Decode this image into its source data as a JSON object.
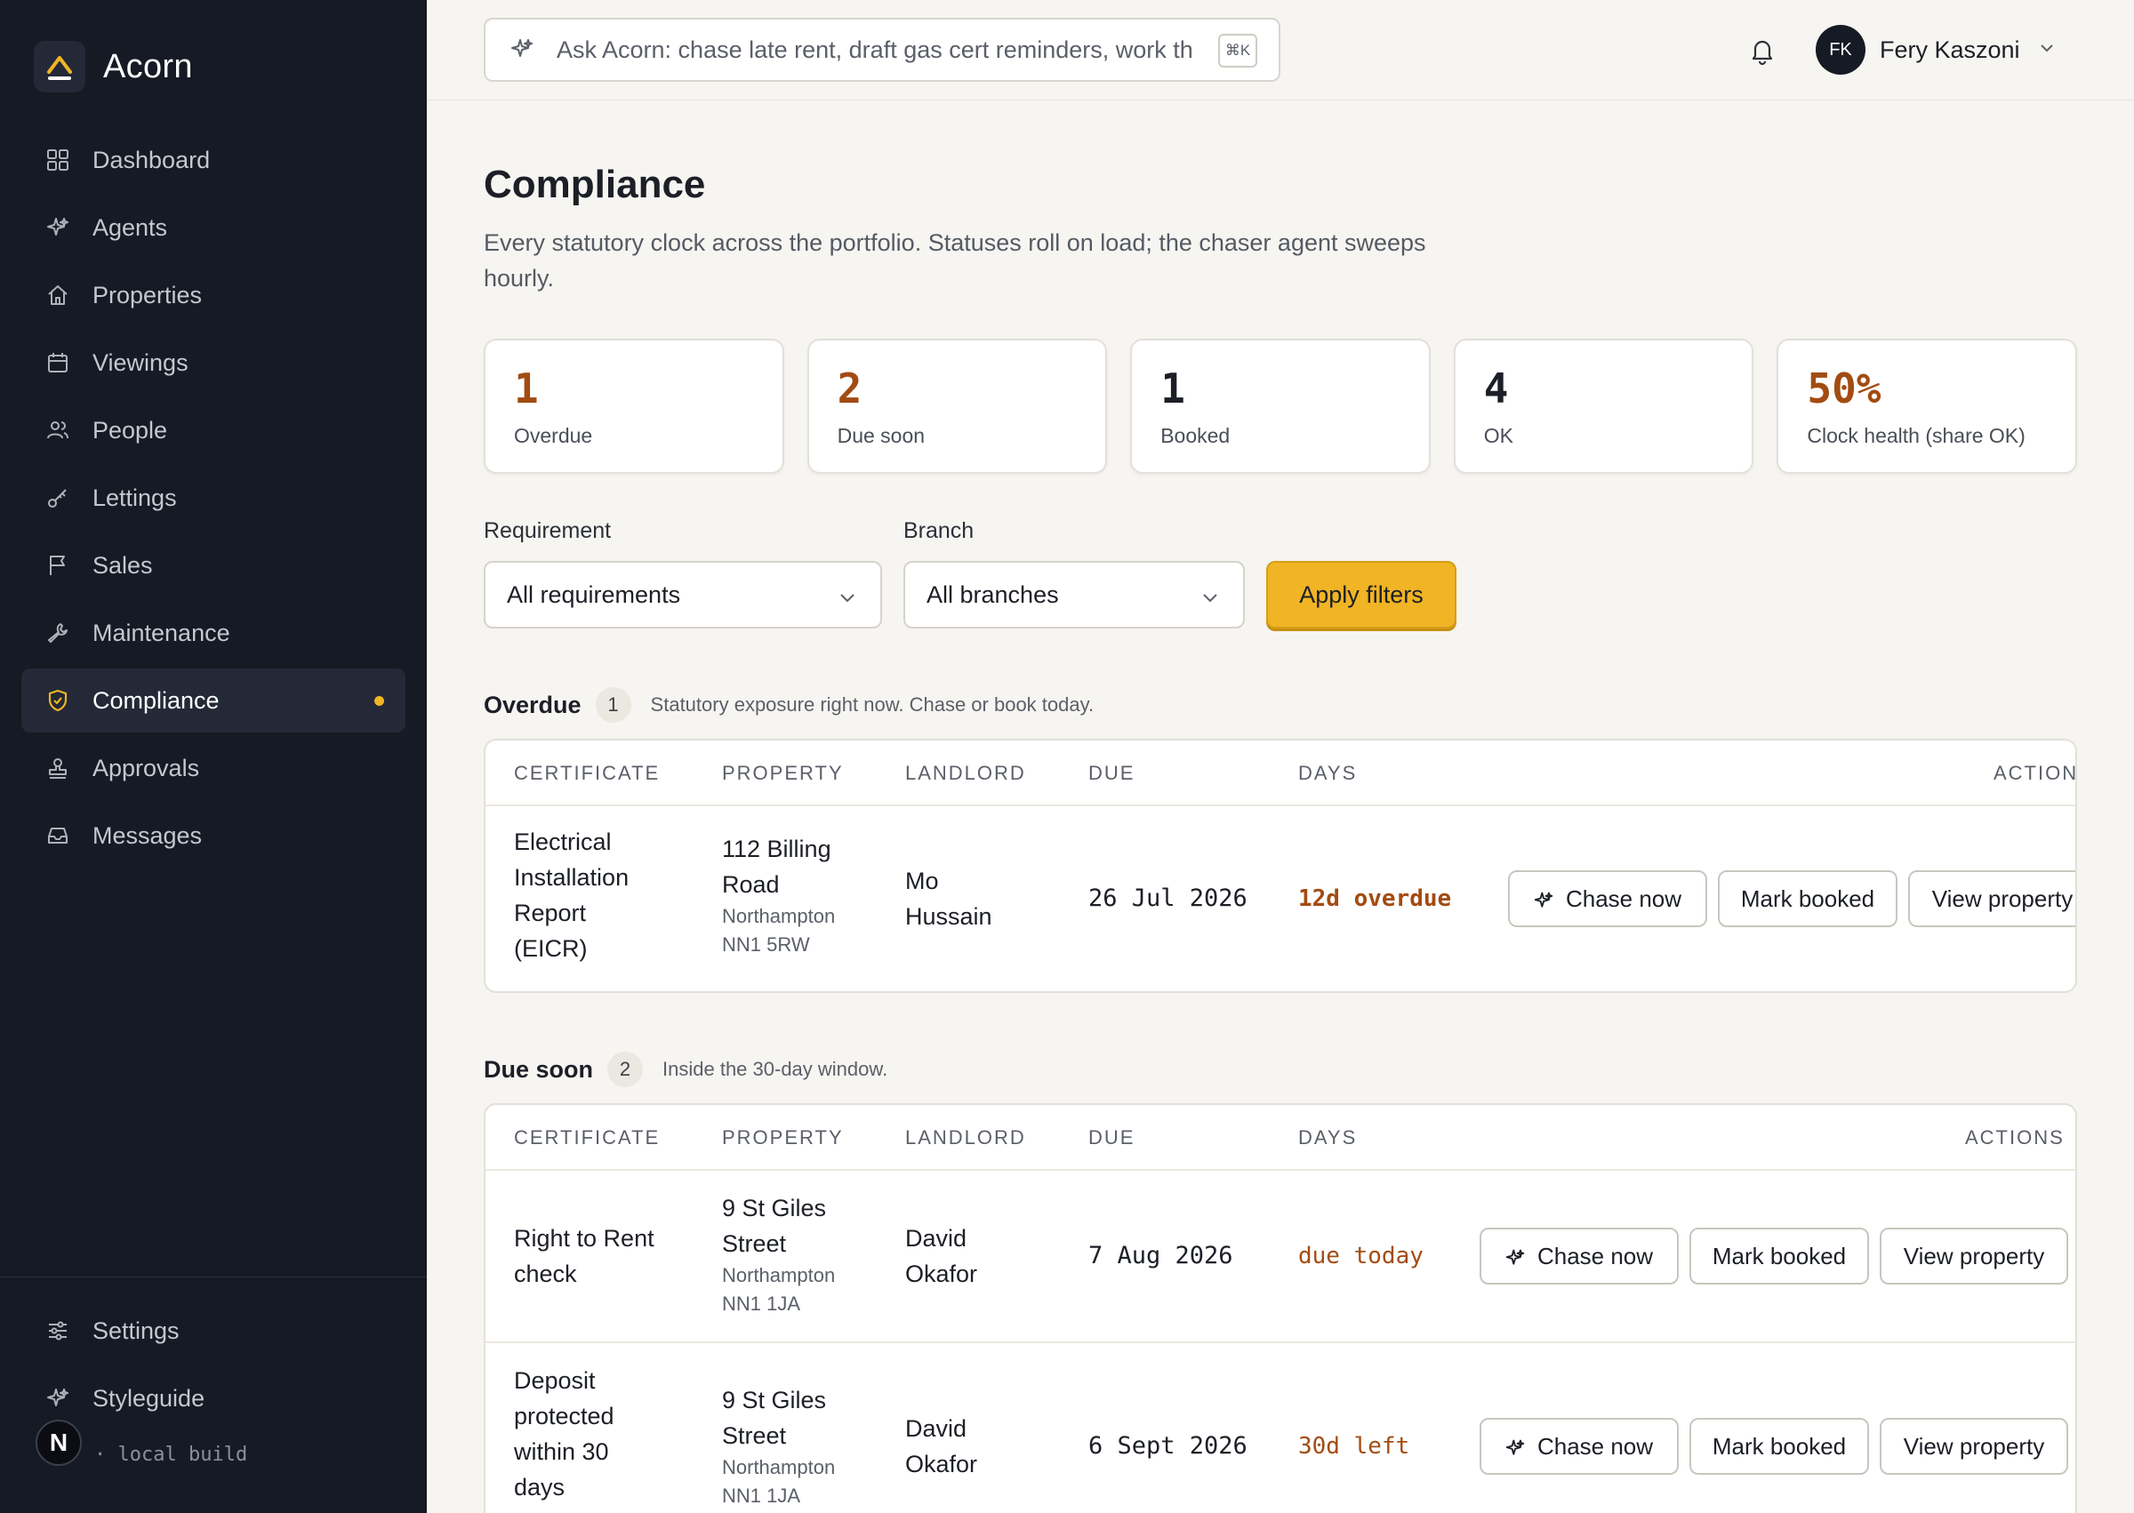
{
  "brand": {
    "name": "Acorn"
  },
  "nav": [
    {
      "label": "Dashboard",
      "icon": "grid-icon"
    },
    {
      "label": "Agents",
      "icon": "sparkle-icon"
    },
    {
      "label": "Properties",
      "icon": "home-icon"
    },
    {
      "label": "Viewings",
      "icon": "calendar-icon"
    },
    {
      "label": "People",
      "icon": "people-icon"
    },
    {
      "label": "Lettings",
      "icon": "key-icon"
    },
    {
      "label": "Sales",
      "icon": "flag-icon"
    },
    {
      "label": "Maintenance",
      "icon": "wrench-icon"
    },
    {
      "label": "Compliance",
      "icon": "shield-icon",
      "active": true
    },
    {
      "label": "Approvals",
      "icon": "stamp-icon"
    },
    {
      "label": "Messages",
      "icon": "inbox-icon"
    }
  ],
  "nav_bottom": [
    {
      "label": "Settings",
      "icon": "sliders-icon"
    },
    {
      "label": "Styleguide",
      "icon": "sparkle-icon"
    }
  ],
  "build": {
    "badge": "N",
    "text": "· local build"
  },
  "search": {
    "placeholder": "Ask Acorn: chase late rent, draft gas cert reminders, work th",
    "shortcut": "⌘K"
  },
  "user": {
    "initials": "FK",
    "name": "Fery Kaszoni"
  },
  "page": {
    "title": "Compliance",
    "subtitle": "Every statutory clock across the portfolio. Statuses roll on load; the chaser agent sweeps hourly."
  },
  "stats": [
    {
      "value": "1",
      "label": "Overdue",
      "color": "#a24c12"
    },
    {
      "value": "2",
      "label": "Due soon",
      "color": "#a24c12"
    },
    {
      "value": "1",
      "label": "Booked",
      "color": "#1c1f26"
    },
    {
      "value": "4",
      "label": "OK",
      "color": "#1c1f26"
    },
    {
      "value": "50%",
      "label": "Clock health (share OK)",
      "color": "#a24c12"
    }
  ],
  "filters": {
    "requirement_label": "Requirement",
    "requirement_value": "All requirements",
    "branch_label": "Branch",
    "branch_value": "All branches",
    "apply_label": "Apply filters"
  },
  "columns": {
    "certificate": "CERTIFICATE",
    "property": "PROPERTY",
    "landlord": "LANDLORD",
    "due": "DUE",
    "days": "DAYS",
    "action_clipped": "ACTION",
    "actions": "ACTIONS"
  },
  "buttons": {
    "chase": "Chase now",
    "booked": "Mark booked",
    "view": "View property"
  },
  "overdue": {
    "title": "Overdue",
    "count": "1",
    "desc": "Statutory exposure right now. Chase or book today.",
    "rows": [
      {
        "certificate": [
          "Electrical",
          "Installation",
          "Report",
          "(EICR)"
        ],
        "property": [
          "112 Billing",
          "Road"
        ],
        "postal": [
          "Northampton",
          "NN1 5RW"
        ],
        "landlord": [
          "Mo",
          "Hussain"
        ],
        "due": "26 Jul 2026",
        "days": "12d overdue"
      }
    ]
  },
  "due_soon": {
    "title": "Due soon",
    "count": "2",
    "desc": "Inside the 30-day window.",
    "rows": [
      {
        "certificate": [
          "Right to Rent",
          "check"
        ],
        "property": [
          "9 St Giles",
          "Street"
        ],
        "postal": [
          "Northampton",
          "NN1 1JA"
        ],
        "landlord": [
          "David",
          "Okafor"
        ],
        "due": "7 Aug 2026",
        "days": "due today"
      },
      {
        "certificate": [
          "Deposit",
          "protected",
          "within 30",
          "days"
        ],
        "property": [
          "9 St Giles",
          "Street"
        ],
        "postal": [
          "Northampton",
          "NN1 1JA"
        ],
        "landlord": [
          "David",
          "Okafor"
        ],
        "due": "6 Sept 2026",
        "days": "30d left"
      }
    ]
  }
}
